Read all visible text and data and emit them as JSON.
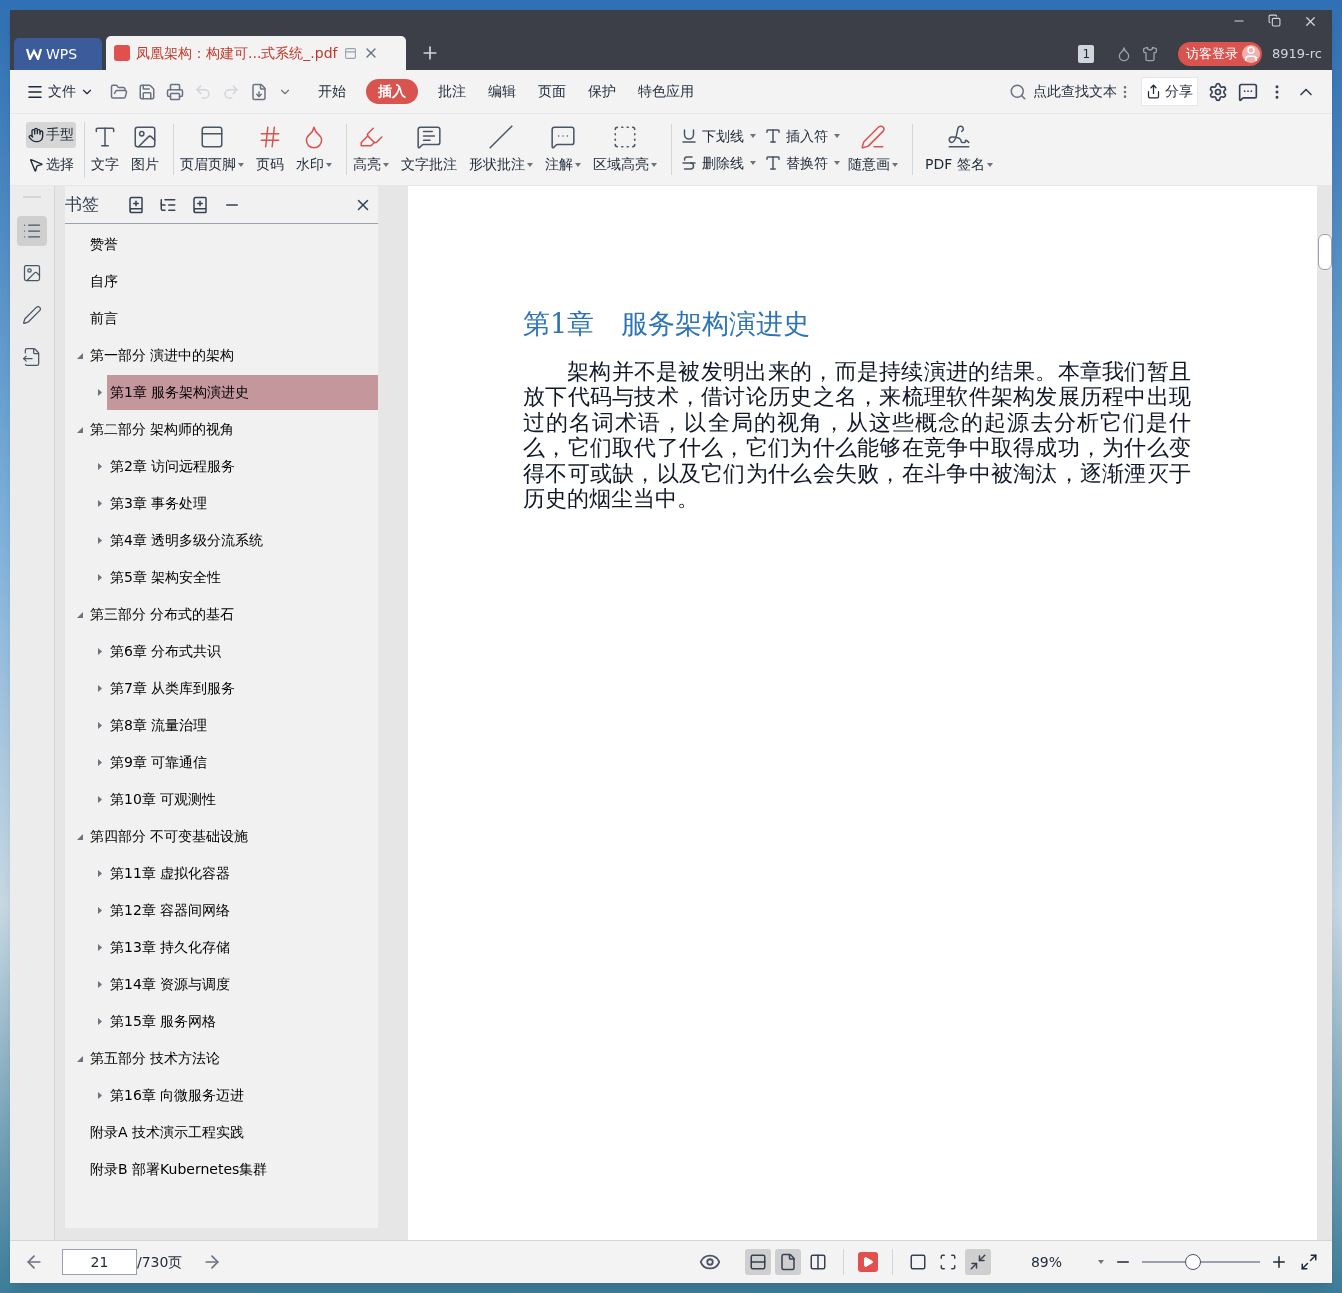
{
  "tabs": [
    {
      "label": "WPS",
      "kind": "home",
      "selected": false
    },
    {
      "label": "凤凰架构：构建可...式系统_.pdf",
      "kind": "document",
      "selected": true
    }
  ],
  "title_bar": {
    "badge": "1",
    "login": "访客登录",
    "version": "8919-rc"
  },
  "menu": {
    "file": "文件",
    "tabs": [
      {
        "label": "开始",
        "selected": false
      },
      {
        "label": "插入",
        "selected": true
      },
      {
        "label": "批注",
        "selected": false
      },
      {
        "label": "编辑",
        "selected": false
      },
      {
        "label": "页面",
        "selected": false
      },
      {
        "label": "保护",
        "selected": false
      },
      {
        "label": "特色应用",
        "selected": false
      }
    ],
    "search": "点此查找文本",
    "share": "分享"
  },
  "toolbar": {
    "modes": [
      {
        "label": "手型",
        "selected": true
      },
      {
        "label": "选择",
        "selected": false
      }
    ],
    "tools": [
      {
        "label": "文字",
        "dropdown": false
      },
      {
        "label": "图片",
        "dropdown": false
      },
      {
        "label": "页眉页脚",
        "dropdown": true
      },
      {
        "label": "页码",
        "dropdown": false
      },
      {
        "label": "水印",
        "dropdown": true
      },
      {
        "label": "高亮",
        "dropdown": true
      },
      {
        "label": "文字批注",
        "dropdown": false
      },
      {
        "label": "形状批注",
        "dropdown": true
      },
      {
        "label": "注解",
        "dropdown": true
      },
      {
        "label": "区域高亮",
        "dropdown": true
      }
    ],
    "small_tools": [
      {
        "label": "下划线",
        "dropdown": true
      },
      {
        "label": "删除线",
        "dropdown": true
      },
      {
        "label": "插入符",
        "dropdown": true
      },
      {
        "label": "替换符",
        "dropdown": true
      }
    ],
    "draw_tool": {
      "label": "随意画",
      "dropdown": true
    },
    "sign_tool": {
      "label": "PDF 签名",
      "dropdown": true
    }
  },
  "rail": [
    {
      "selected": true
    },
    {
      "selected": false
    },
    {
      "selected": false
    },
    {
      "selected": false
    }
  ],
  "sidebar": {
    "title": "书签",
    "bookmarks": [
      {
        "label": "赞誉",
        "selected": false
      },
      {
        "label": "自序",
        "selected": false
      },
      {
        "label": "前言",
        "selected": false
      },
      {
        "label": "第一部分 演进中的架构",
        "selected": false,
        "expanded": true,
        "children": [
          {
            "label": "第1章 服务架构演进史",
            "selected": true,
            "expanded": false
          }
        ]
      },
      {
        "label": "第二部分 架构师的视角",
        "selected": false,
        "expanded": true,
        "children": [
          {
            "label": "第2章 访问远程服务",
            "selected": false,
            "expanded": false
          },
          {
            "label": "第3章 事务处理",
            "selected": false,
            "expanded": false
          },
          {
            "label": "第4章 透明多级分流系统",
            "selected": false,
            "expanded": false
          },
          {
            "label": "第5章 架构安全性",
            "selected": false,
            "expanded": false
          }
        ]
      },
      {
        "label": "第三部分 分布式的基石",
        "selected": false,
        "expanded": true,
        "children": [
          {
            "label": "第6章 分布式共识",
            "selected": false,
            "expanded": false
          },
          {
            "label": "第7章 从类库到服务",
            "selected": false,
            "expanded": false
          },
          {
            "label": "第8章 流量治理",
            "selected": false,
            "expanded": false
          },
          {
            "label": "第9章 可靠通信",
            "selected": false,
            "expanded": false
          },
          {
            "label": "第10章 可观测性",
            "selected": false,
            "expanded": false
          }
        ]
      },
      {
        "label": "第四部分 不可变基础设施",
        "selected": false,
        "expanded": true,
        "children": [
          {
            "label": "第11章 虚拟化容器",
            "selected": false,
            "expanded": false
          },
          {
            "label": "第12章 容器间网络",
            "selected": false,
            "expanded": false
          },
          {
            "label": "第13章 持久化存储",
            "selected": false,
            "expanded": false
          },
          {
            "label": "第14章 资源与调度",
            "selected": false,
            "expanded": false
          },
          {
            "label": "第15章 服务网格",
            "selected": false,
            "expanded": false
          }
        ]
      },
      {
        "label": "第五部分 技术方法论",
        "selected": false,
        "expanded": true,
        "children": [
          {
            "label": "第16章 向微服务迈进",
            "selected": false,
            "expanded": false
          }
        ]
      },
      {
        "label": "附录A 技术演示工程实践",
        "selected": false
      },
      {
        "label": "附录B 部署Kubernetes集群",
        "selected": false
      }
    ]
  },
  "document": {
    "heading": "第1章　服务架构演进史",
    "paragraph": "架构并不是被发明出来的，而是持续演进的结果。本章我们暂且放下代码与技术，借讨论历史之名，来梳理软件架构发展历程中出现过的名词术语，以全局的视角，从这些概念的起源去分析它们是什么，它们取代了什么，它们为什么能够在竞争中取得成功，为什么变得不可或缺，以及它们为什么会失败，在斗争中被淘汰，逐渐湮灭于历史的烟尘当中。"
  },
  "status_bar": {
    "page": "21",
    "total": "/730页",
    "view_modes": [
      {
        "selected": true
      },
      {
        "selected": true
      },
      {
        "selected": false
      }
    ],
    "fit_modes": [
      {
        "selected": false
      },
      {
        "selected": false
      },
      {
        "selected": true
      }
    ],
    "zoom": "89%",
    "level": 0.43
  }
}
